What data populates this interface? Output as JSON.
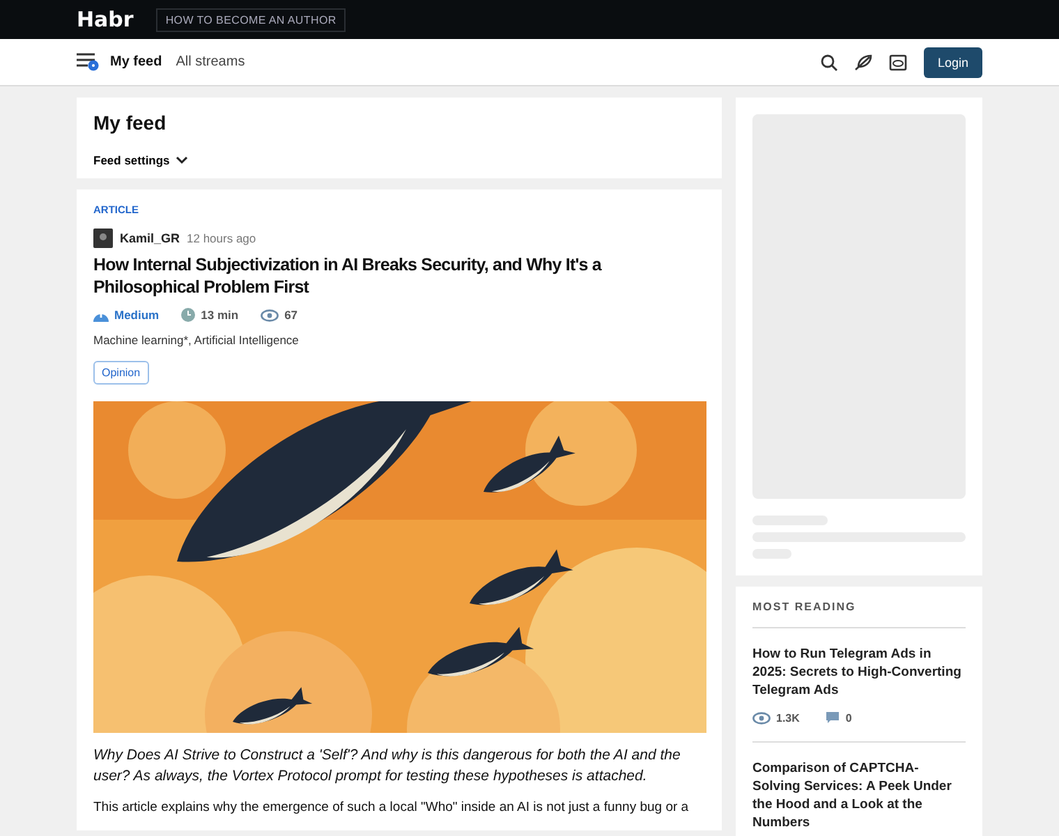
{
  "top_bar": {
    "logo": "Habr",
    "author_link": "HOW TO BECOME AN AUTHOR"
  },
  "nav": {
    "items": [
      {
        "label": "My feed",
        "selected": true
      },
      {
        "label": "All streams",
        "selected": false
      }
    ],
    "login": "Login"
  },
  "feed_header": {
    "title": "My feed",
    "settings": "Feed settings"
  },
  "article": {
    "type": "ARTICLE",
    "author": "Kamil_GR",
    "time": "12 hours ago",
    "title": "How Internal Subjectivization in AI Breaks Security, and Why It's a Philosophical Problem First",
    "complexity": "Medium",
    "reading_time": "13 min",
    "views": "67",
    "hubs": "Machine learning*, Artificial Intelligence",
    "tag": "Opinion",
    "lead": "Why Does AI Strive to Construct a 'Self'? And why is this dangerous for both the AI and the user? As always, the Vortex Protocol prompt for testing these hypotheses is attached.",
    "body": "This article explains why the emergence of such a local \"Who\" inside an AI is not just a funny bug or a"
  },
  "most_reading": {
    "title": "MOST READING",
    "items": [
      {
        "title": "How to Run Telegram Ads in 2025: Secrets to High-Converting Telegram Ads",
        "views": "1.3K",
        "comments": "0"
      },
      {
        "title": "Comparison of CAPTCHA-Solving Services: A Peek Under the Hood and a Look at the Numbers"
      }
    ]
  }
}
